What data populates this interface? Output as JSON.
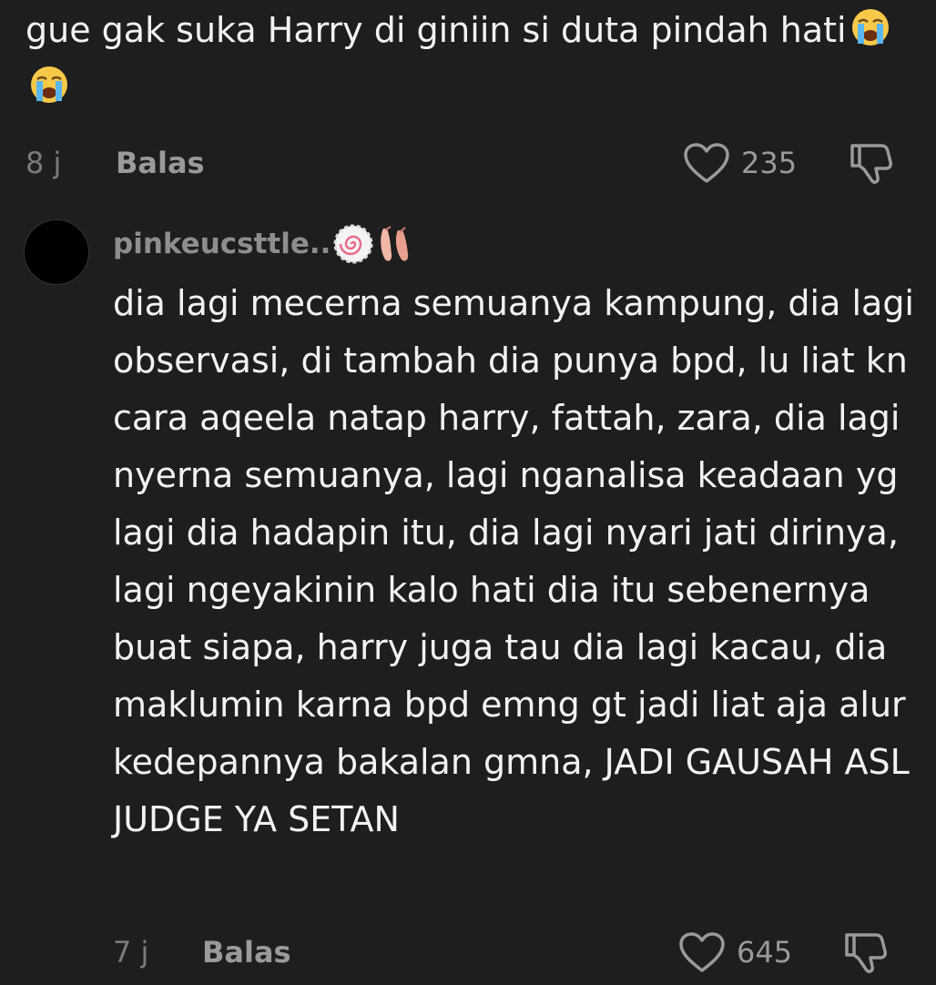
{
  "comment1": {
    "text": "gue gak suka Harry di giniin si duta pindah hati",
    "emoji": [
      "crying-face",
      "crying-face"
    ],
    "time": "8 j",
    "reply_label": "Balas",
    "likes": "235"
  },
  "comment2": {
    "username": "pinkeucsttle..",
    "username_emoji": [
      "fish-cake",
      "ballet-shoes"
    ],
    "text": "dia lagi mecerna semuanya kampung, dia lagi observasi, di tambah dia punya bpd, lu liat kn cara aqeela natap harry, fattah, zara, dia lagi nyerna semuanya, lagi nganalisa keadaan yg lagi dia hadapin itu, dia lagi nyari jati dirinya, lagi ngeyakinin kalo hati dia itu sebenernya buat siapa, harry juga tau dia lagi kacau, dia maklumin karna bpd emng gt jadi liat aja alur kedepannya bakalan gmna, JADI GAUSAH ASL JUDGE YA SETAN",
    "time": "7 j",
    "reply_label": "Balas",
    "likes": "645"
  },
  "colors": {
    "background": "#1e1e1e",
    "text": "#f2f2f2",
    "muted": "#8f8f8f"
  }
}
